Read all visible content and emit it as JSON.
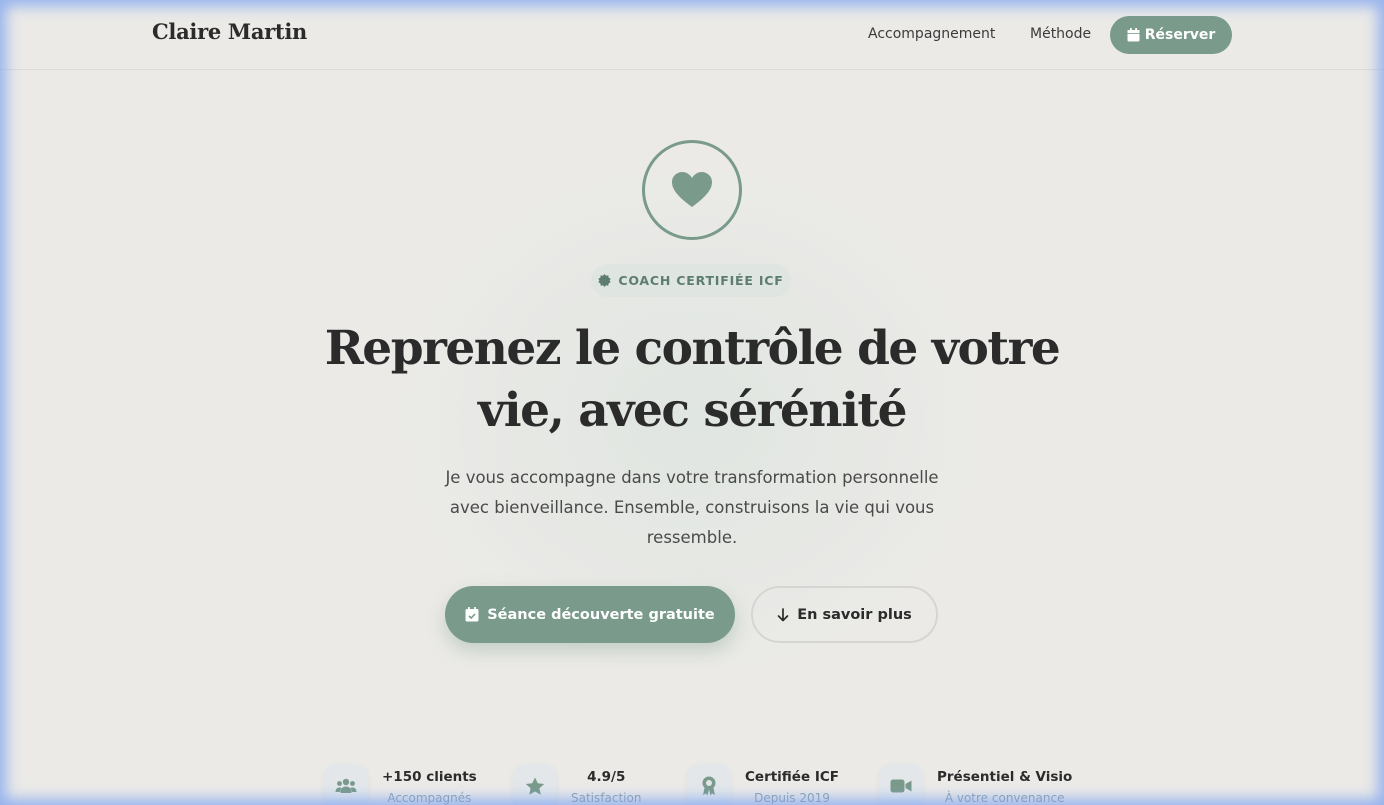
{
  "brand": {
    "name": "Claire Martin"
  },
  "nav": {
    "links": [
      "Accompagnement",
      "Méthode"
    ],
    "reserve_label": "Réserver"
  },
  "hero": {
    "badge": "COACH CERTIFIÉE ICF",
    "title": "Reprenez le contrôle de votre vie, avec sérénité",
    "subtitle": "Je vous accompagne dans votre transformation personnelle avec bienveillance. Ensemble, construisons la vie qui vous ressemble.",
    "primary_cta": "Séance découverte gratuite",
    "secondary_cta": "En savoir plus"
  },
  "stats": [
    {
      "icon": "users-icon",
      "title": "+150 clients",
      "sub": "Accompagnés"
    },
    {
      "icon": "star-icon",
      "title": "4.9/5",
      "sub": "Satisfaction"
    },
    {
      "icon": "award-icon",
      "title": "Certifiée ICF",
      "sub": "Depuis 2019"
    },
    {
      "icon": "video-icon",
      "title": "Présentiel & Visio",
      "sub": "À votre convenance"
    }
  ],
  "colors": {
    "accent": "#7a9a8b",
    "background": "#ebeae7",
    "text": "#2b2b2b"
  }
}
